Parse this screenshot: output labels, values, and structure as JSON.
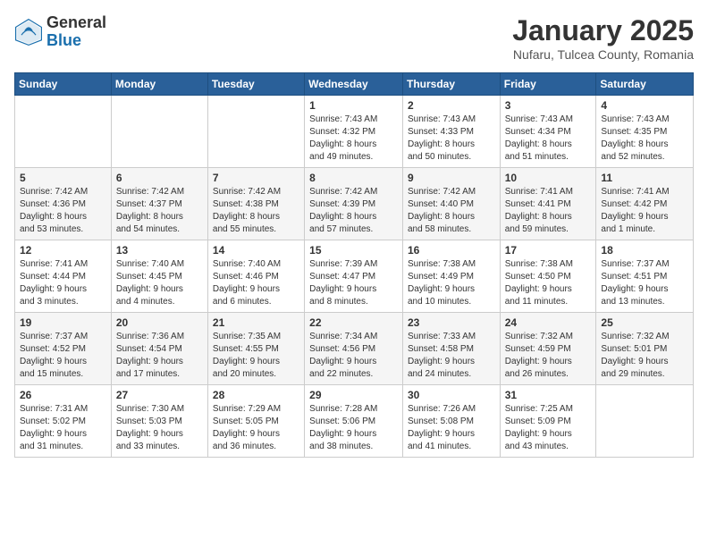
{
  "header": {
    "logo_general": "General",
    "logo_blue": "Blue",
    "month_title": "January 2025",
    "location": "Nufaru, Tulcea County, Romania"
  },
  "days_of_week": [
    "Sunday",
    "Monday",
    "Tuesday",
    "Wednesday",
    "Thursday",
    "Friday",
    "Saturday"
  ],
  "weeks": [
    [
      {
        "day": "",
        "info": ""
      },
      {
        "day": "",
        "info": ""
      },
      {
        "day": "",
        "info": ""
      },
      {
        "day": "1",
        "info": "Sunrise: 7:43 AM\nSunset: 4:32 PM\nDaylight: 8 hours\nand 49 minutes."
      },
      {
        "day": "2",
        "info": "Sunrise: 7:43 AM\nSunset: 4:33 PM\nDaylight: 8 hours\nand 50 minutes."
      },
      {
        "day": "3",
        "info": "Sunrise: 7:43 AM\nSunset: 4:34 PM\nDaylight: 8 hours\nand 51 minutes."
      },
      {
        "day": "4",
        "info": "Sunrise: 7:43 AM\nSunset: 4:35 PM\nDaylight: 8 hours\nand 52 minutes."
      }
    ],
    [
      {
        "day": "5",
        "info": "Sunrise: 7:42 AM\nSunset: 4:36 PM\nDaylight: 8 hours\nand 53 minutes."
      },
      {
        "day": "6",
        "info": "Sunrise: 7:42 AM\nSunset: 4:37 PM\nDaylight: 8 hours\nand 54 minutes."
      },
      {
        "day": "7",
        "info": "Sunrise: 7:42 AM\nSunset: 4:38 PM\nDaylight: 8 hours\nand 55 minutes."
      },
      {
        "day": "8",
        "info": "Sunrise: 7:42 AM\nSunset: 4:39 PM\nDaylight: 8 hours\nand 57 minutes."
      },
      {
        "day": "9",
        "info": "Sunrise: 7:42 AM\nSunset: 4:40 PM\nDaylight: 8 hours\nand 58 minutes."
      },
      {
        "day": "10",
        "info": "Sunrise: 7:41 AM\nSunset: 4:41 PM\nDaylight: 8 hours\nand 59 minutes."
      },
      {
        "day": "11",
        "info": "Sunrise: 7:41 AM\nSunset: 4:42 PM\nDaylight: 9 hours\nand 1 minute."
      }
    ],
    [
      {
        "day": "12",
        "info": "Sunrise: 7:41 AM\nSunset: 4:44 PM\nDaylight: 9 hours\nand 3 minutes."
      },
      {
        "day": "13",
        "info": "Sunrise: 7:40 AM\nSunset: 4:45 PM\nDaylight: 9 hours\nand 4 minutes."
      },
      {
        "day": "14",
        "info": "Sunrise: 7:40 AM\nSunset: 4:46 PM\nDaylight: 9 hours\nand 6 minutes."
      },
      {
        "day": "15",
        "info": "Sunrise: 7:39 AM\nSunset: 4:47 PM\nDaylight: 9 hours\nand 8 minutes."
      },
      {
        "day": "16",
        "info": "Sunrise: 7:38 AM\nSunset: 4:49 PM\nDaylight: 9 hours\nand 10 minutes."
      },
      {
        "day": "17",
        "info": "Sunrise: 7:38 AM\nSunset: 4:50 PM\nDaylight: 9 hours\nand 11 minutes."
      },
      {
        "day": "18",
        "info": "Sunrise: 7:37 AM\nSunset: 4:51 PM\nDaylight: 9 hours\nand 13 minutes."
      }
    ],
    [
      {
        "day": "19",
        "info": "Sunrise: 7:37 AM\nSunset: 4:52 PM\nDaylight: 9 hours\nand 15 minutes."
      },
      {
        "day": "20",
        "info": "Sunrise: 7:36 AM\nSunset: 4:54 PM\nDaylight: 9 hours\nand 17 minutes."
      },
      {
        "day": "21",
        "info": "Sunrise: 7:35 AM\nSunset: 4:55 PM\nDaylight: 9 hours\nand 20 minutes."
      },
      {
        "day": "22",
        "info": "Sunrise: 7:34 AM\nSunset: 4:56 PM\nDaylight: 9 hours\nand 22 minutes."
      },
      {
        "day": "23",
        "info": "Sunrise: 7:33 AM\nSunset: 4:58 PM\nDaylight: 9 hours\nand 24 minutes."
      },
      {
        "day": "24",
        "info": "Sunrise: 7:32 AM\nSunset: 4:59 PM\nDaylight: 9 hours\nand 26 minutes."
      },
      {
        "day": "25",
        "info": "Sunrise: 7:32 AM\nSunset: 5:01 PM\nDaylight: 9 hours\nand 29 minutes."
      }
    ],
    [
      {
        "day": "26",
        "info": "Sunrise: 7:31 AM\nSunset: 5:02 PM\nDaylight: 9 hours\nand 31 minutes."
      },
      {
        "day": "27",
        "info": "Sunrise: 7:30 AM\nSunset: 5:03 PM\nDaylight: 9 hours\nand 33 minutes."
      },
      {
        "day": "28",
        "info": "Sunrise: 7:29 AM\nSunset: 5:05 PM\nDaylight: 9 hours\nand 36 minutes."
      },
      {
        "day": "29",
        "info": "Sunrise: 7:28 AM\nSunset: 5:06 PM\nDaylight: 9 hours\nand 38 minutes."
      },
      {
        "day": "30",
        "info": "Sunrise: 7:26 AM\nSunset: 5:08 PM\nDaylight: 9 hours\nand 41 minutes."
      },
      {
        "day": "31",
        "info": "Sunrise: 7:25 AM\nSunset: 5:09 PM\nDaylight: 9 hours\nand 43 minutes."
      },
      {
        "day": "",
        "info": ""
      }
    ]
  ]
}
